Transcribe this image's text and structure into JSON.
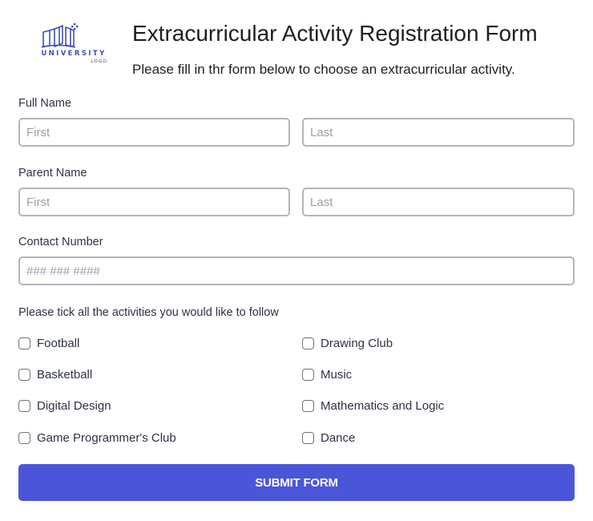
{
  "logo": {
    "icon": "book-logo-icon",
    "word": "UNIVERSITY",
    "sub": "LOGO"
  },
  "header": {
    "title": "Extracurricular Activity Registration Form",
    "subtitle": "Please fill in thr form below to choose an extracurricular activity."
  },
  "full_name": {
    "label": "Full Name",
    "first_placeholder": "First",
    "last_placeholder": "Last"
  },
  "parent_name": {
    "label": "Parent Name",
    "first_placeholder": "First",
    "last_placeholder": "Last"
  },
  "contact": {
    "label": "Contact Number",
    "placeholder": "### ### ####"
  },
  "activities": {
    "label": "Please tick all the activities you would like to follow",
    "options": [
      {
        "label": "Football",
        "checked": false
      },
      {
        "label": "Basketball",
        "checked": false
      },
      {
        "label": "Digital Design",
        "checked": false
      },
      {
        "label": "Game Programmer's Club",
        "checked": false
      },
      {
        "label": "Drawing Club",
        "checked": false
      },
      {
        "label": "Music",
        "checked": false
      },
      {
        "label": "Mathematics and Logic",
        "checked": false
      },
      {
        "label": "Dance",
        "checked": false
      }
    ]
  },
  "submit": {
    "label": "SUBMIT FORM"
  },
  "colors": {
    "accent": "#4b55d9",
    "logo": "#3e4fb8",
    "border": "#b1b5bd",
    "text": "#2c3345"
  }
}
